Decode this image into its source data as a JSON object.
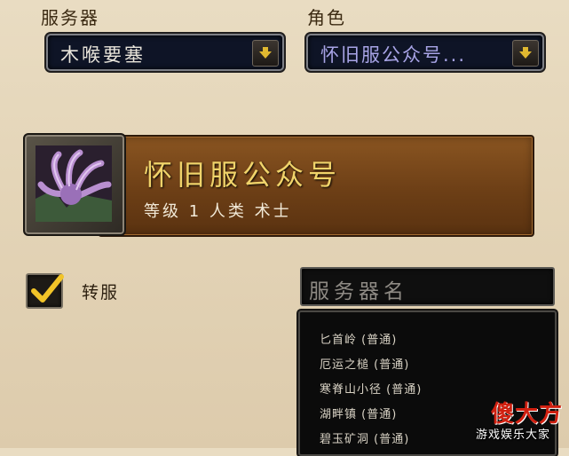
{
  "server_select": {
    "label": "服务器",
    "value": "木喉要塞"
  },
  "character_select": {
    "label": "角色",
    "value": "怀旧服公众号..."
  },
  "character_card": {
    "name": "怀旧服公众号",
    "level_line": "等级 1 人类 术士"
  },
  "transfer_checkbox": {
    "label": "转服",
    "checked": true
  },
  "server_list": {
    "header": "服务器名",
    "items": [
      "匕首岭 (普通)",
      "厄运之槌 (普通)",
      "寒脊山小径 (普通)",
      "湖畔镇 (普通)",
      "碧玉矿洞 (普通)"
    ]
  },
  "watermark": {
    "logo": "傻大方",
    "tagline": "游戏娱乐大家"
  },
  "icons": [
    "dropdown-arrow-icon",
    "checkmark-icon",
    "warlock-portrait-icon"
  ],
  "colors": {
    "gold_text": "#f0d36a",
    "card_brown": "#7a4a1c",
    "dropdown_bg": "#0e1426"
  }
}
